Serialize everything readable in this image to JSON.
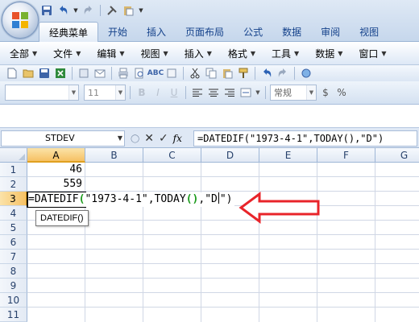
{
  "app": {
    "accent": "#15428b",
    "arrow_color": "#e8242a"
  },
  "tabs": [
    {
      "label": "经典菜单",
      "active": true
    },
    {
      "label": "开始"
    },
    {
      "label": "插入"
    },
    {
      "label": "页面布局"
    },
    {
      "label": "公式"
    },
    {
      "label": "数据"
    },
    {
      "label": "审阅"
    },
    {
      "label": "视图"
    }
  ],
  "menubar": {
    "items": [
      {
        "label": "全部"
      },
      {
        "label": "文件"
      },
      {
        "label": "编辑"
      },
      {
        "label": "视图"
      },
      {
        "label": "插入"
      },
      {
        "label": "格式"
      },
      {
        "label": "工具"
      },
      {
        "label": "数据"
      },
      {
        "label": "窗口"
      }
    ]
  },
  "toolbar": {
    "font_size": "11",
    "number_format": "常规",
    "percent": "%"
  },
  "formula_bar": {
    "name_box": "STDEV",
    "fx": "fx",
    "formula": "=DATEDIF(\"1973-4-1\",TODAY(),\"D\")"
  },
  "columns": [
    "A",
    "B",
    "C",
    "D",
    "E",
    "F",
    "G"
  ],
  "rows": [
    "1",
    "2",
    "3",
    "4",
    "5",
    "6",
    "7",
    "8",
    "9",
    "10",
    "11"
  ],
  "cells": {
    "A1": "46",
    "A2": "559"
  },
  "editing": {
    "formula_prefix": "=DATEDIF",
    "open_paren": "(",
    "arg1": "\"1973-4-1\"",
    "comma1": ",",
    "arg2": "TODAY",
    "today_parens": "()",
    "comma2": ",",
    "arg3_open": "\"D",
    "arg3_close": "\"",
    "close_paren": ")",
    "tooltip": "DATEDIF()"
  },
  "icons": [
    "office-logo",
    "save-icon",
    "undo-icon",
    "redo-icon",
    "format-painter-icon",
    "paste-icon",
    "cut-icon",
    "copy-icon",
    "bold-icon",
    "align-left-icon",
    "align-center-icon",
    "align-right-icon",
    "merge-icon",
    "cancel-x-icon",
    "enter-check-icon",
    "red-arrow-icon"
  ]
}
